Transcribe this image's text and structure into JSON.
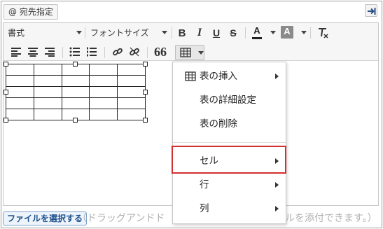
{
  "mention_button": "@ 宛先指定",
  "toolbar": {
    "format_select": "書式",
    "font_size_select": "フォントサイズ",
    "bold_icon": "B",
    "italic_icon": "I",
    "underline_icon": "U",
    "strike_icon": "S",
    "text_color_icon": "A",
    "bg_color_icon": "A",
    "quote_icon": "66"
  },
  "context_menu": {
    "insert_table": "表の挿入",
    "table_properties": "表の詳細設定",
    "delete_table": "表の削除",
    "cell": "セル",
    "row": "行",
    "column": "列"
  },
  "footer": {
    "file_button": "ファイルを選択する",
    "drop_hint_left": "（ドラッグアンドド",
    "drop_hint_right": "ルを添付できます。）"
  },
  "table": {
    "rows": 5,
    "cols": 5
  },
  "colors": {
    "highlight_border": "#d32f2f",
    "file_button_text": "#1c4f8c"
  }
}
